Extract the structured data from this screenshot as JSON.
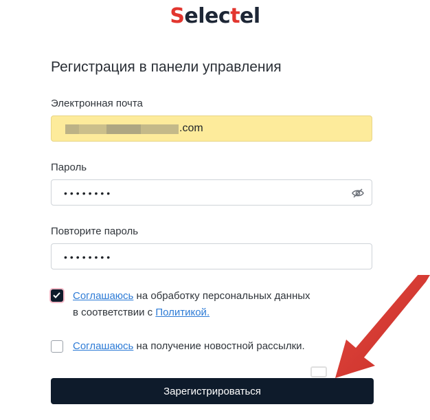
{
  "logo": {
    "part1": "S",
    "part2": "elec",
    "part3": "t",
    "part4": "el"
  },
  "form": {
    "title": "Регистрация в панели управления",
    "email": {
      "label": "Электронная почта",
      "visible_suffix": ".com"
    },
    "password": {
      "label": "Пароль",
      "masked": "••••••••"
    },
    "password_repeat": {
      "label": "Повторите пароль",
      "masked": "••••••••"
    },
    "consent_personal": {
      "checked": true,
      "link_agree": "Соглашаюсь",
      "text": "на обработку персональных данных",
      "text2": "в соответствии с",
      "link_policy": "Политикой."
    },
    "consent_newsletter": {
      "checked": false,
      "link_agree": "Соглашаюсь",
      "text": "на получение новостной рассылки."
    },
    "submit_label": "Зарегистрироваться"
  },
  "colors": {
    "accent_red": "#e2362f",
    "dark": "#0e1b2b",
    "link": "#2d7bd6",
    "autofill": "#fdeb9b"
  },
  "icons": {
    "password_toggle": "eye-slash-icon",
    "annotation": "red-arrow"
  }
}
